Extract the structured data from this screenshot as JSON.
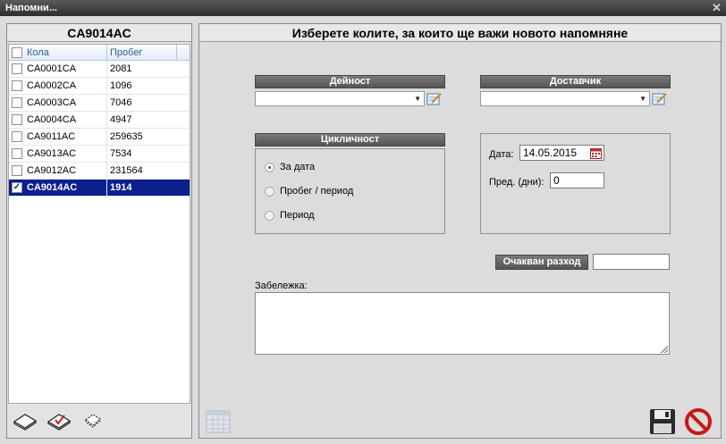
{
  "window": {
    "title": "Напомни...",
    "close_glyph": "✕"
  },
  "left": {
    "title": "CA9014AC",
    "columns": [
      "Кола",
      "Пробег"
    ],
    "rows": [
      {
        "car": "CA0001CA",
        "mileage": "2081",
        "checked": false,
        "selected": false
      },
      {
        "car": "CA0002CA",
        "mileage": "1096",
        "checked": false,
        "selected": false
      },
      {
        "car": "CA0003CA",
        "mileage": "7046",
        "checked": false,
        "selected": false
      },
      {
        "car": "CA0004CA",
        "mileage": "4947",
        "checked": false,
        "selected": false
      },
      {
        "car": "CA9011AC",
        "mileage": "259635",
        "checked": false,
        "selected": false
      },
      {
        "car": "CA9013AC",
        "mileage": "7534",
        "checked": false,
        "selected": false
      },
      {
        "car": "CA9012AC",
        "mileage": "231564",
        "checked": false,
        "selected": false
      },
      {
        "car": "CA9014AC",
        "mileage": "1914",
        "checked": true,
        "selected": true
      }
    ],
    "footer_icons": [
      "uncheck-all-icon",
      "check-all-icon",
      "invert-selection-icon"
    ]
  },
  "right": {
    "title": "Изберете колите, за които ще важи новото напомняне",
    "activity_label": "Дейност",
    "activity_value": "",
    "supplier_label": "Доставчик",
    "supplier_value": "",
    "cyclic_label": "Цикличност",
    "radios": [
      {
        "label": "За дата",
        "checked": true
      },
      {
        "label": "Пробег / период",
        "checked": false
      },
      {
        "label": "Период",
        "checked": false
      }
    ],
    "date_label": "Дата:",
    "date_value": "14.05.2015",
    "days_label": "Пред. (дни):",
    "days_value": "0",
    "expected_cost_label": "Очакван разход",
    "expected_cost_value": "",
    "note_label": "Забележка:",
    "note_value": "",
    "footer_icons": [
      "calendar-icon",
      "save-icon",
      "cancel-icon"
    ]
  },
  "colors": {
    "selected_row": "#0c1f8f",
    "header_text": "#2a5aa0",
    "label_bar": "#5f5f5f"
  }
}
